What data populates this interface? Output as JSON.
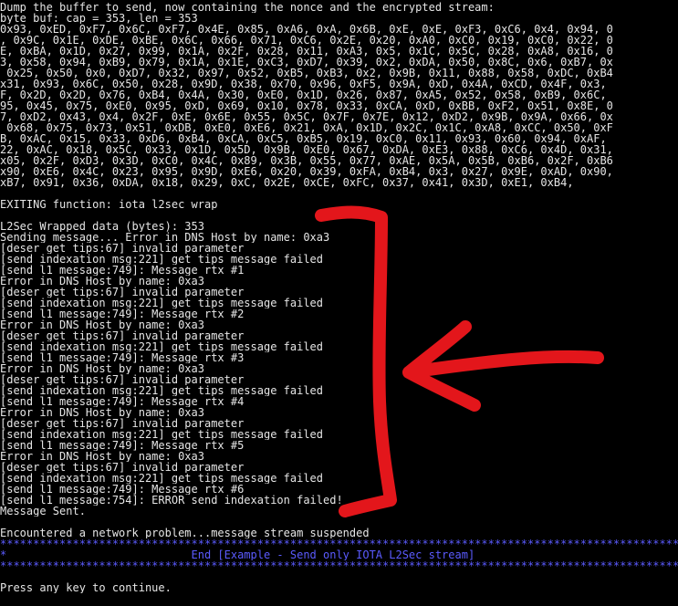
{
  "console": {
    "lines": [
      {
        "text": "Dump the buffer to send, now containing the nonce and the encrypted stream:",
        "style": "normal"
      },
      {
        "text": "byte_buf: cap = 353, len = 353",
        "style": "normal"
      },
      {
        "text": "0x93, 0xED, 0xF7, 0x6C, 0xF7, 0x4E, 0x85, 0xA6, 0xA, 0x6B, 0xE, 0xE, 0xF3, 0xC6, 0x4, 0x94, 0",
        "style": "normal"
      },
      {
        "text": ", 0x9C, 0x1E, 0xDE, 0xBE, 0x6C, 0x66, 0x71, 0xC6, 0x2E, 0x20, 0xA0, 0xC0, 0x19, 0xC0, 0x22, 0",
        "style": "normal"
      },
      {
        "text": "E, 0xBA, 0x1D, 0x27, 0x99, 0x1A, 0x2F, 0x28, 0x11, 0xA3, 0x5, 0x1C, 0x5C, 0x28, 0xA8, 0x16, 0",
        "style": "normal"
      },
      {
        "text": "3, 0x58, 0x94, 0xB9, 0x79, 0x1A, 0x1E, 0xC3, 0xD7, 0x39, 0x2, 0xDA, 0x50, 0x8C, 0x6, 0xB7, 0x",
        "style": "normal"
      },
      {
        "text": " 0x25, 0x50, 0x0, 0xD7, 0x32, 0x97, 0x52, 0xB5, 0xB3, 0x2, 0x9B, 0x11, 0x88, 0x58, 0xDC, 0xB4",
        "style": "normal"
      },
      {
        "text": "x31, 0x93, 0x6C, 0x50, 0x28, 0x9D, 0x38, 0x70, 0x96, 0xF5, 0x9A, 0xD, 0x4A, 0xCD, 0x4F, 0x3,",
        "style": "normal"
      },
      {
        "text": "F, 0x2D, 0x2D, 0x76, 0xB4, 0x4A, 0x30, 0xE0, 0x1D, 0x26, 0x87, 0xA5, 0x52, 0x58, 0xB9, 0x6C,",
        "style": "normal"
      },
      {
        "text": "95, 0x45, 0x75, 0xE0, 0x95, 0xD, 0x69, 0x10, 0x78, 0x33, 0xCA, 0xD, 0xBB, 0xF2, 0x51, 0x8E, 0",
        "style": "normal"
      },
      {
        "text": "7, 0xD2, 0x43, 0x4, 0x2F, 0xE, 0x6E, 0x55, 0x5C, 0x7F, 0x7E, 0x12, 0xD2, 0x9B, 0x9A, 0x66, 0x",
        "style": "normal"
      },
      {
        "text": " 0x68, 0x75, 0x73, 0x51, 0xDB, 0xE0, 0xE6, 0x21, 0xA, 0x1D, 0x2C, 0x1C, 0xA8, 0xCC, 0x50, 0xF",
        "style": "normal"
      },
      {
        "text": "B, 0xAC, 0x15, 0x33, 0xD6, 0xB4, 0xCA, 0xC5, 0xB5, 0x19, 0xC0, 0x11, 0x93, 0x60, 0x94, 0xAF,",
        "style": "normal"
      },
      {
        "text": "22, 0xAC, 0x18, 0x5C, 0x33, 0x1D, 0x5D, 0x9B, 0xE0, 0x67, 0xDA, 0xE3, 0x88, 0xC6, 0x4D, 0x31,",
        "style": "normal"
      },
      {
        "text": "x05, 0x2F, 0xD3, 0x3D, 0xC0, 0x4C, 0x89, 0x3B, 0x55, 0x77, 0xAE, 0x5A, 0x5B, 0xB6, 0x2F, 0xB6",
        "style": "normal"
      },
      {
        "text": "x90, 0xE6, 0x4C, 0x23, 0x95, 0x9D, 0xE6, 0x20, 0x39, 0xFA, 0xB4, 0x3, 0x27, 0x9E, 0xAD, 0x90,",
        "style": "normal"
      },
      {
        "text": "xB7, 0x91, 0x36, 0xDA, 0x18, 0x29, 0xC, 0x2E, 0xCE, 0xFC, 0x37, 0x41, 0x3D, 0xE1, 0xB4,",
        "style": "normal"
      },
      {
        "text": "",
        "style": "normal"
      },
      {
        "text": "EXITING function: iota_l2sec_wrap",
        "style": "normal"
      },
      {
        "text": "",
        "style": "normal"
      },
      {
        "text": "L2Sec Wrapped data (bytes): 353",
        "style": "normal"
      },
      {
        "text": "Sending message... Error in DNS Host by name: 0xa3",
        "style": "normal"
      },
      {
        "text": "[deser_get_tips:67] invalid parameter",
        "style": "normal"
      },
      {
        "text": "[send_indexation_msg:221] get tips message failed",
        "style": "normal"
      },
      {
        "text": "[send_l1_message:749]: Message rtx #1",
        "style": "normal"
      },
      {
        "text": "Error in DNS Host by name: 0xa3",
        "style": "normal"
      },
      {
        "text": "[deser_get_tips:67] invalid parameter",
        "style": "normal"
      },
      {
        "text": "[send_indexation_msg:221] get tips message failed",
        "style": "normal"
      },
      {
        "text": "[send_l1_message:749]: Message rtx #2",
        "style": "normal"
      },
      {
        "text": "Error in DNS Host by name: 0xa3",
        "style": "normal"
      },
      {
        "text": "[deser_get_tips:67] invalid parameter",
        "style": "normal"
      },
      {
        "text": "[send_indexation_msg:221] get tips message failed",
        "style": "normal"
      },
      {
        "text": "[send_l1_message:749]: Message rtx #3",
        "style": "normal"
      },
      {
        "text": "Error in DNS Host by name: 0xa3",
        "style": "normal"
      },
      {
        "text": "[deser_get_tips:67] invalid parameter",
        "style": "normal"
      },
      {
        "text": "[send_indexation_msg:221] get tips message failed",
        "style": "normal"
      },
      {
        "text": "[send_l1_message:749]: Message rtx #4",
        "style": "normal"
      },
      {
        "text": "Error in DNS Host by name: 0xa3",
        "style": "normal"
      },
      {
        "text": "[deser_get_tips:67] invalid parameter",
        "style": "normal"
      },
      {
        "text": "[send_indexation_msg:221] get tips message failed",
        "style": "normal"
      },
      {
        "text": "[send_l1_message:749]: Message rtx #5",
        "style": "normal"
      },
      {
        "text": "Error in DNS Host by name: 0xa3",
        "style": "normal"
      },
      {
        "text": "[deser_get_tips:67] invalid parameter",
        "style": "normal"
      },
      {
        "text": "[send_indexation_msg:221] get tips message failed",
        "style": "normal"
      },
      {
        "text": "[send_l1_message:749]: Message rtx #6",
        "style": "normal"
      },
      {
        "text": "[send_l1_message:754]: ERROR send indexation failed!",
        "style": "normal"
      },
      {
        "text": "Message Sent.",
        "style": "normal"
      },
      {
        "text": "",
        "style": "normal"
      },
      {
        "text": "Encountered a network problem...message stream suspended",
        "style": "normal"
      },
      {
        "text": "*********************************************************************************************************",
        "style": "banner-rule"
      },
      {
        "text": "*                            End [Example - Send only IOTA L2Sec stream]",
        "style": "banner-title"
      },
      {
        "text": "*********************************************************************************************************",
        "style": "banner-rule"
      },
      {
        "text": "",
        "style": "normal"
      },
      {
        "text": "Press any key to continue.",
        "style": "normal"
      }
    ]
  },
  "annotation": {
    "bracket_icon": "red-bracket-icon",
    "arrow_icon": "red-arrow-icon",
    "color": "#e3161b"
  },
  "colors": {
    "background": "#000000",
    "text": "#e6e6e6",
    "banner": "#5b5bff"
  }
}
